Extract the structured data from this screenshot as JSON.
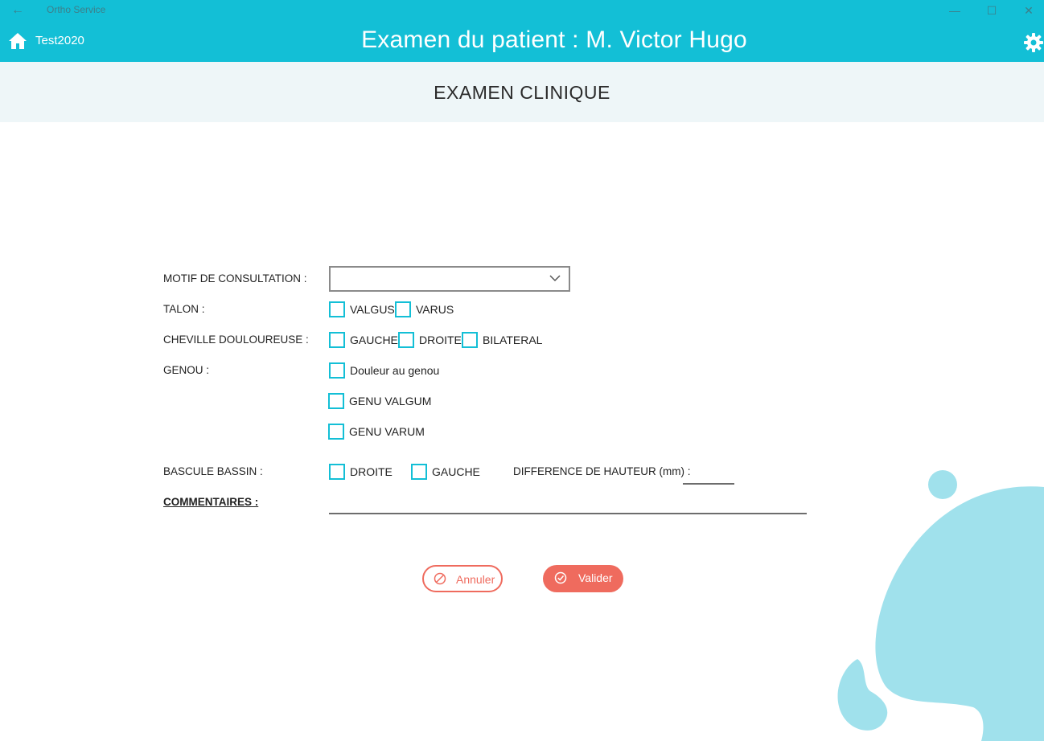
{
  "window": {
    "back_glyph": "←",
    "title": "Ortho Service",
    "minimize_glyph": "—",
    "maximize_glyph": "☐",
    "close_glyph": "✕"
  },
  "header": {
    "user": "Test2020",
    "title": "Examen du patient : M. Victor Hugo",
    "icons": [
      "home-icon",
      "gear-icon"
    ]
  },
  "section": {
    "title": "EXAMEN CLINIQUE"
  },
  "form": {
    "motif": {
      "label": "MOTIF DE CONSULTATION :",
      "value": ""
    },
    "talon": {
      "label": "TALON :",
      "options": [
        "VALGUS",
        "VARUS"
      ]
    },
    "cheville": {
      "label": "CHEVILLE DOULOUREUSE :",
      "options": [
        "GAUCHE",
        "DROITE",
        "BILATERAL"
      ]
    },
    "genou": {
      "label": "GENOU :",
      "options": [
        "Douleur au genou",
        "GENU VALGUM",
        "GENU VARUM"
      ]
    },
    "bassin": {
      "label": "BASCULE BASSIN :",
      "options": [
        "DROITE",
        "GAUCHE"
      ],
      "diff_label": "DIFFERENCE DE HAUTEUR (mm) :",
      "diff_value": ""
    },
    "commentaires": {
      "label": "COMMENTAIRES :",
      "value": ""
    }
  },
  "buttons": {
    "cancel": "Annuler",
    "ok": "Valider"
  },
  "colors": {
    "primary": "#13bfd6",
    "accent": "#ef6b5e",
    "band": "#eef6f8",
    "deco": "#a0e1ec"
  }
}
